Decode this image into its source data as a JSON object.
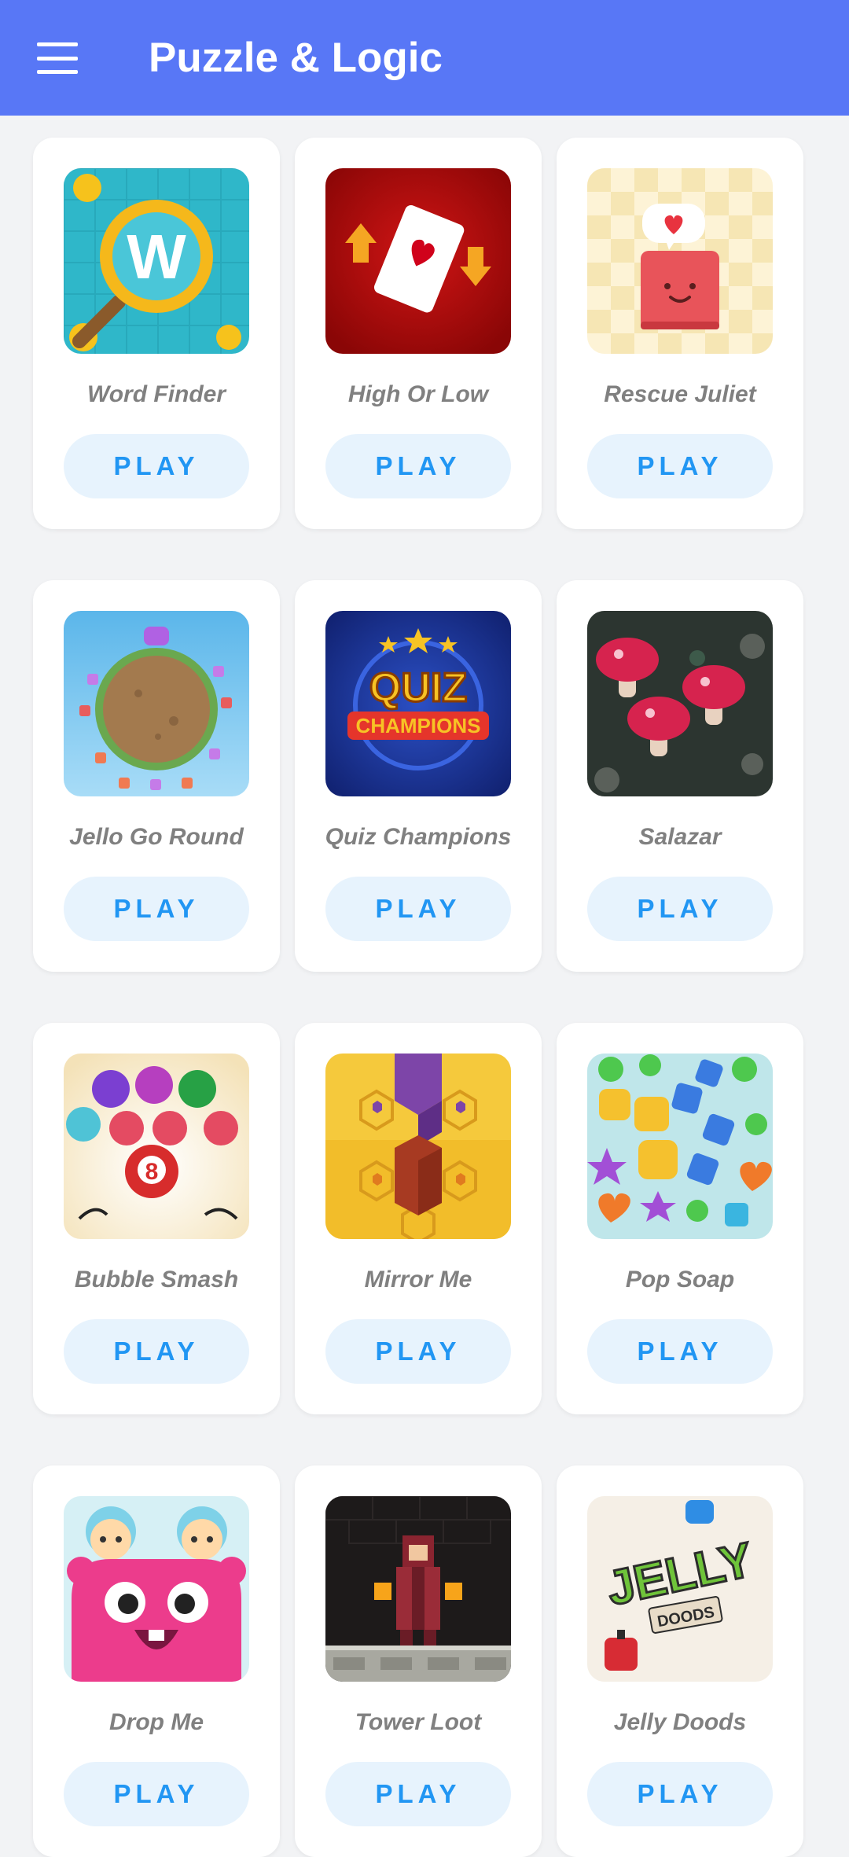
{
  "appbar": {
    "title": "Puzzle & Logic",
    "menu_icon": "hamburger-menu-icon"
  },
  "colors": {
    "appbar": "#5877f6",
    "play_bg": "#e7f3fd",
    "play_text": "#2196f3",
    "name_text": "#808080"
  },
  "games": [
    {
      "name": "Word Finder",
      "play_label": "PLAY"
    },
    {
      "name": "High Or Low",
      "play_label": "PLAY"
    },
    {
      "name": "Rescue Juliet",
      "play_label": "PLAY"
    },
    {
      "name": "Jello Go Round",
      "play_label": "PLAY"
    },
    {
      "name": "Quiz Champions",
      "play_label": "PLAY"
    },
    {
      "name": "Salazar",
      "play_label": "PLAY"
    },
    {
      "name": "Bubble Smash",
      "play_label": "PLAY"
    },
    {
      "name": "Mirror Me",
      "play_label": "PLAY"
    },
    {
      "name": "Pop Soap",
      "play_label": "PLAY"
    },
    {
      "name": "Drop Me",
      "play_label": "PLAY"
    },
    {
      "name": "Tower Loot",
      "play_label": "PLAY"
    },
    {
      "name": "Jelly Doods",
      "play_label": "PLAY"
    }
  ],
  "thumb_text": {
    "word_finder_letter": "W",
    "quiz_line1": "QUIZ",
    "quiz_line2": "CHAMPIONS",
    "jelly_line1": "JELLY",
    "jelly_line2": "DOODS",
    "bubble_number": "8"
  }
}
